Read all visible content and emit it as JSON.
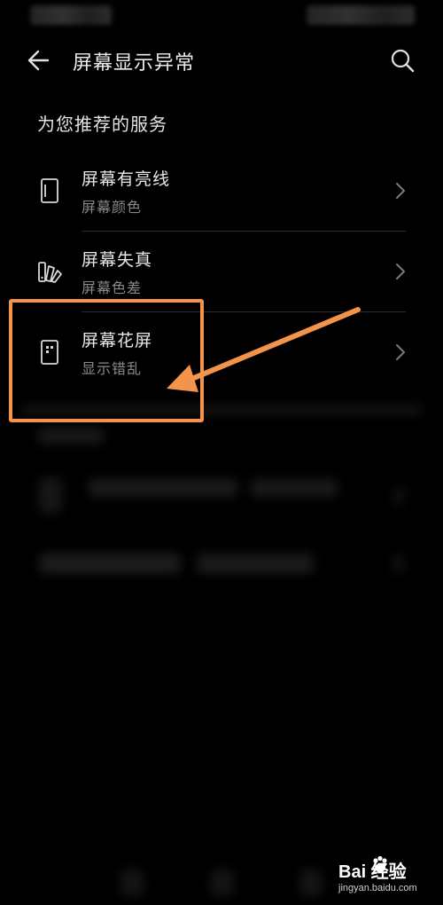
{
  "header": {
    "title": "屏幕显示异常",
    "back_icon": "arrow-left-icon",
    "search_icon": "search-icon"
  },
  "recommended": {
    "section_title": "为您推荐的服务",
    "items": [
      {
        "title": "屏幕有亮线",
        "subtitle": "屏幕颜色",
        "icon": "phone-screen-icon"
      },
      {
        "title": "屏幕失真",
        "subtitle": "屏幕色差",
        "icon": "color-palette-icon"
      },
      {
        "title": "屏幕花屏",
        "subtitle": "显示错乱",
        "icon": "phone-pixel-icon"
      }
    ]
  },
  "annotation": {
    "highlight_color": "#f4934a",
    "arrow_color": "#f4934a"
  },
  "watermark": {
    "brand": "Bai 经验",
    "url": "jingyan.baidu.com"
  },
  "colors": {
    "background": "#000000",
    "primary_text": "#e8e8e8",
    "secondary_text": "#8a8a8a",
    "divider": "#2b2b2b"
  }
}
